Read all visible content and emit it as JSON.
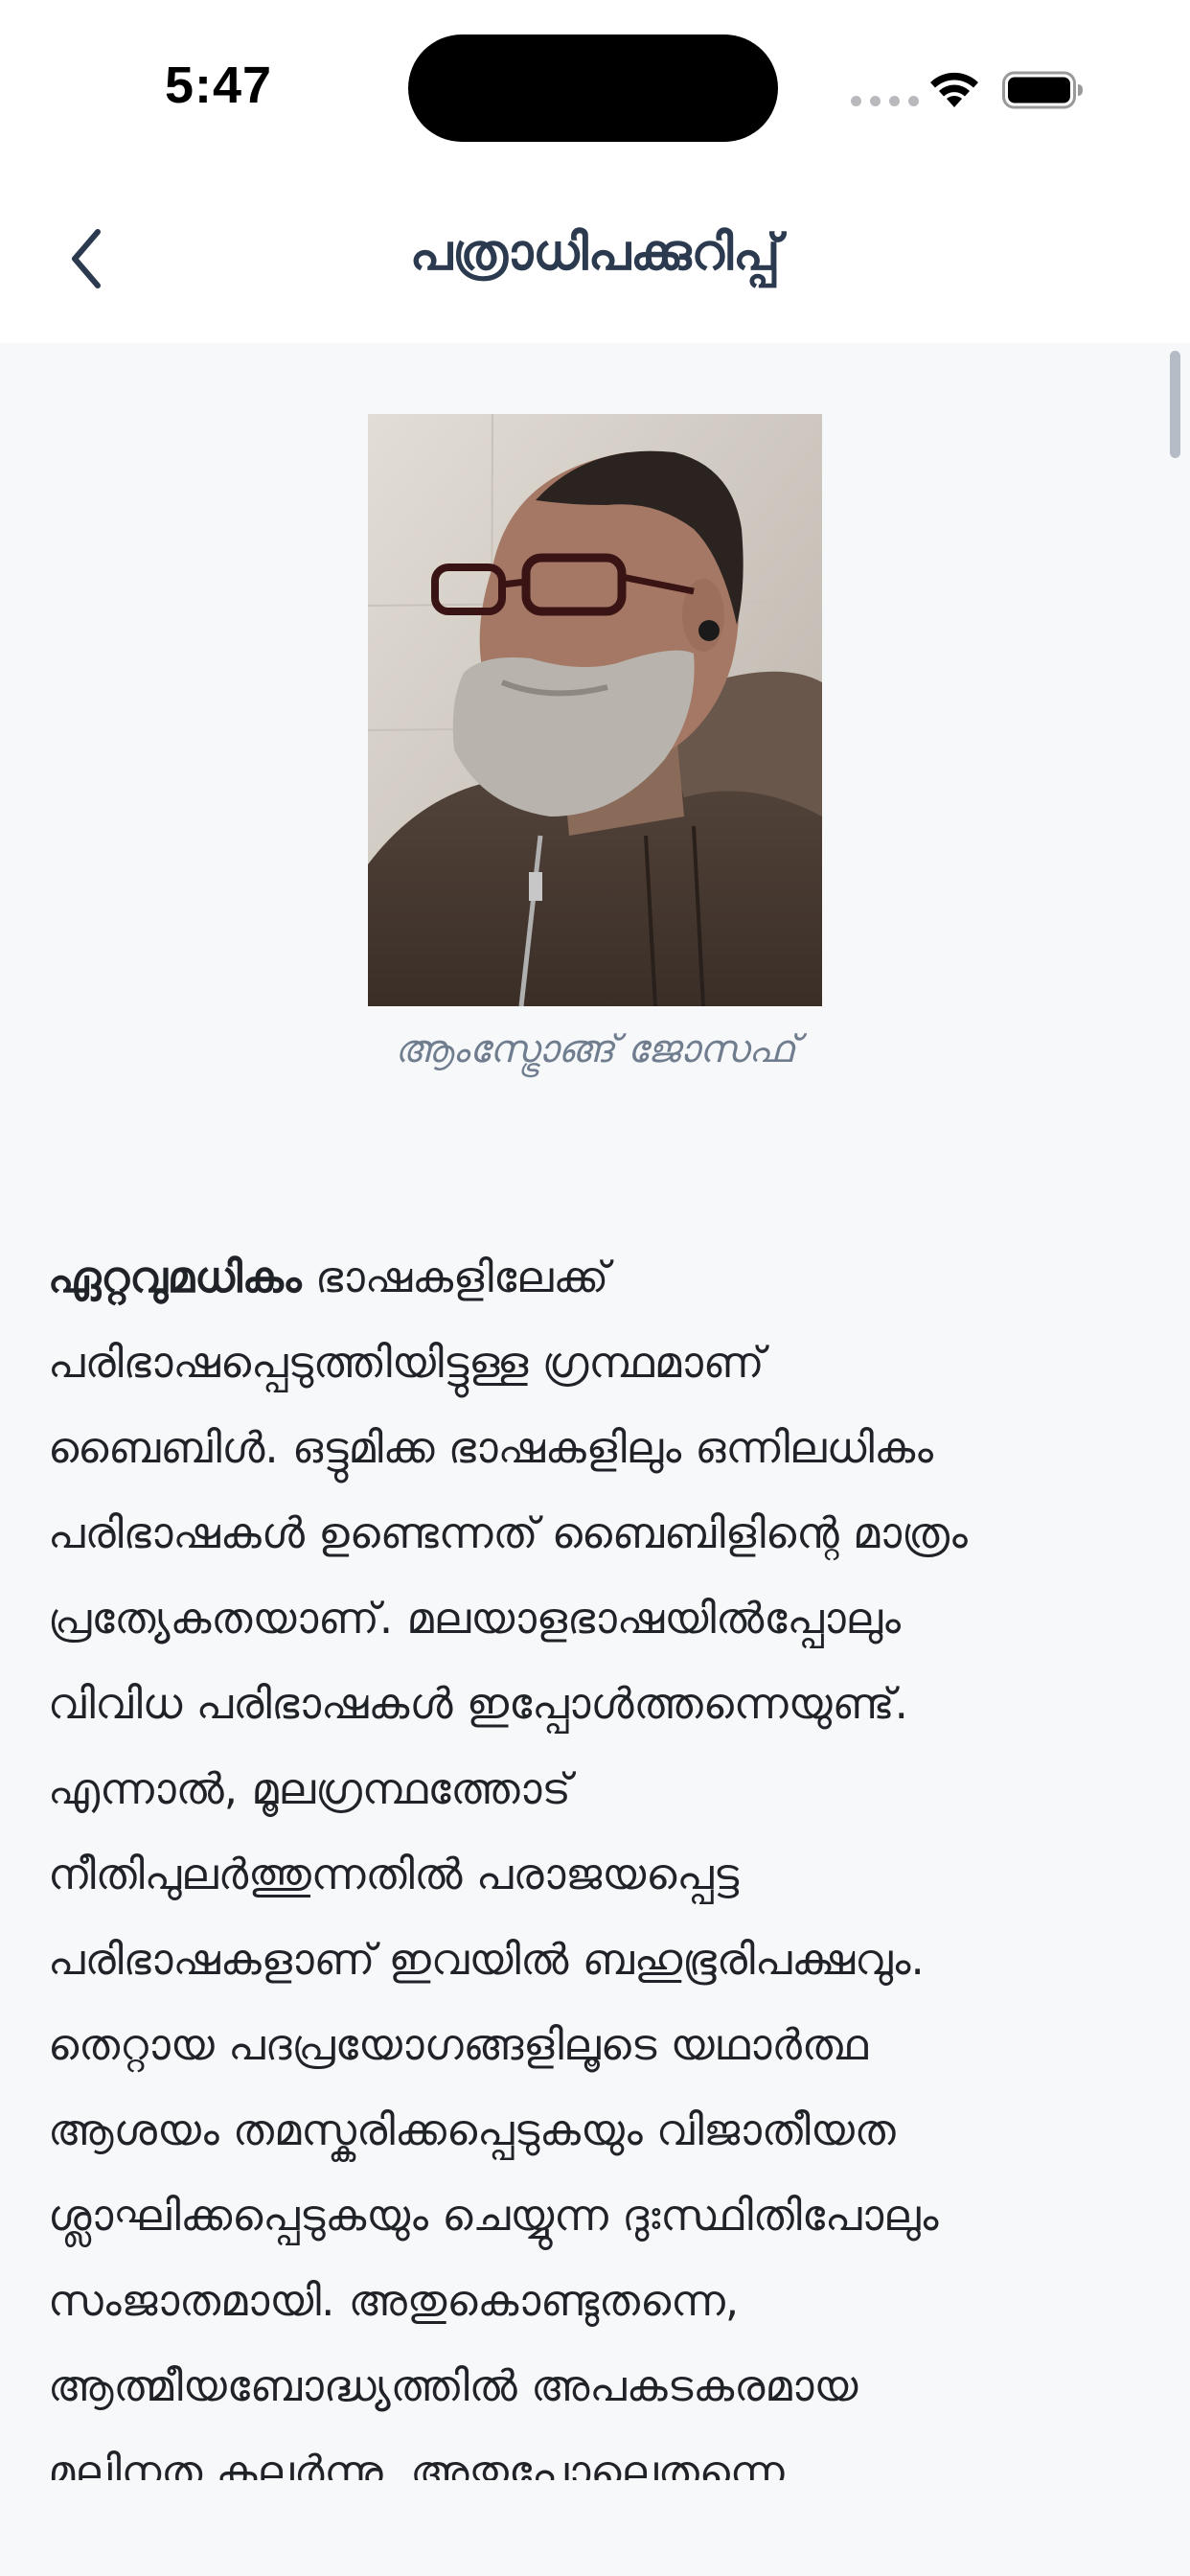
{
  "status_bar": {
    "time": "5:47"
  },
  "nav": {
    "title": "പത്രാധിപക്കുറിപ്പ്",
    "back_icon": "chevron-left-icon"
  },
  "author": {
    "name": "ആംസ്ട്രോങ്ങ് ജോസഫ്"
  },
  "article": {
    "first_word": "ഏറ്റവുമധികം",
    "first_line_rest": " ഭാഷകളിലേക്ക്",
    "lines": [
      "പരിഭാഷപ്പെടുത്തിയിട്ടുള്ള ഗ്രന്ഥമാണ്",
      "ബൈബിൾ. ഒട്ടുമിക്ക ഭാഷകളിലും ഒന്നിലധികം",
      "പരിഭാഷകൾ ഉണ്ടെന്നത് ബൈബിളിന്റെ മാത്രം",
      "പ്രത്യേകതയാണ്. മലയാളഭാഷയിൽപ്പോലും",
      "വിവിധ പരിഭാഷകൾ ഇപ്പോൾത്തന്നെയുണ്ട്.",
      "എന്നാൽ, മൂലഗ്രന്ഥത്തോട്",
      "നീതിപുലർത്തുന്നതിൽ പരാജയപ്പെട്ട",
      "പരിഭാഷകളാണ് ഇവയിൽ ബഹുഭൂരിപക്ഷവും.",
      "തെറ്റായ പദപ്രയോഗങ്ങളിലൂടെ യഥാർത്ഥ",
      "ആശയം തമസ്കരിക്കപ്പെടുകയും വിജാതീയത",
      "ശ്ലാഘിക്കപ്പെടുകയും ചെയ്യുന്ന ദുഃസ്ഥിതിപോലും",
      "സംജാതമായി. അതുകൊണ്ടുതന്നെ,",
      "ആത്മീയബോദ്ധ്യത്തിൽ അപകടകരമായ",
      "മലിനത കലർന്നു. അതുപോലെതന്നെ"
    ]
  },
  "colors": {
    "title": "#2b3a4f",
    "caption": "#6f7d8e",
    "body_text": "#1f2328",
    "background": "#f7f8fa"
  }
}
